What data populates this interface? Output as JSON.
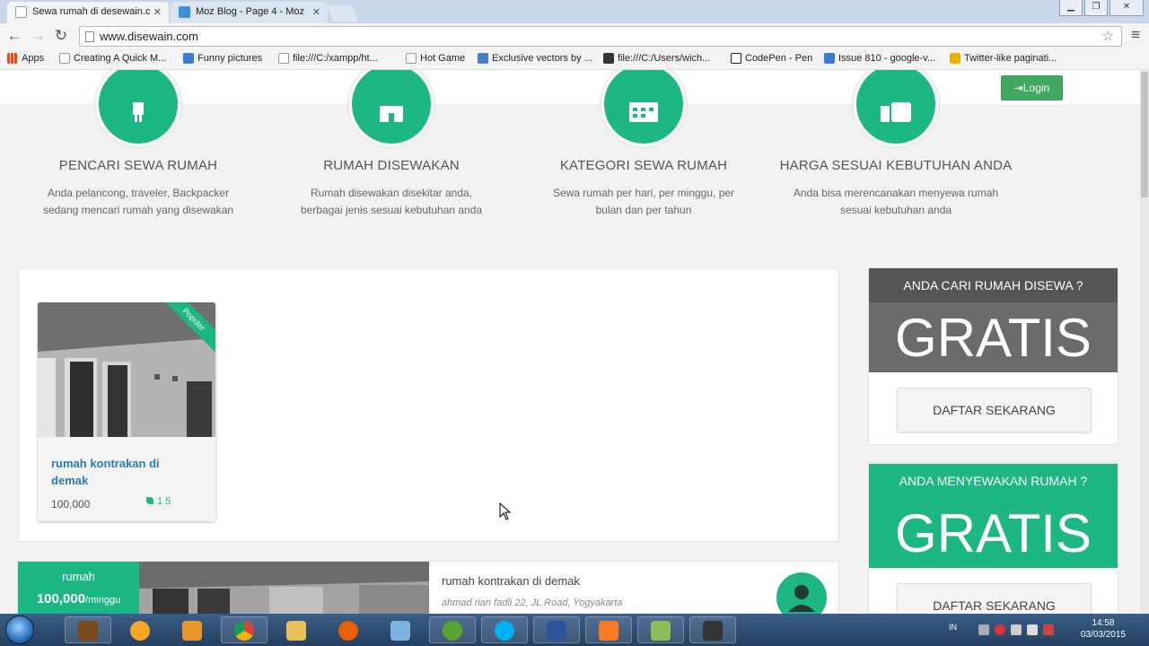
{
  "browser": {
    "tabs": [
      {
        "title": "Sewa rumah di desewain.c",
        "active": true,
        "favicon_color": "#ffffff"
      },
      {
        "title": "Moz Blog - Page 4 - Moz",
        "active": false,
        "favicon_color": "#3d8fe0"
      }
    ],
    "url": "www.disewain.com",
    "bookmarks": [
      {
        "label": "Apps",
        "icon_color": "#e64a19"
      },
      {
        "label": "Creating A Quick M...",
        "icon_color": "#ffffff"
      },
      {
        "label": "Funny pictures",
        "icon_color": "#3a7bd5"
      },
      {
        "label": "file:///C:/xampp/ht...",
        "icon_color": "#ffffff"
      },
      {
        "label": "Hot Game",
        "icon_color": "#ffffff"
      },
      {
        "label": "Exclusive vectors by ...",
        "icon_color": "#4a7fc1"
      },
      {
        "label": "file:///C:/Users/wich...",
        "icon_color": "#333333"
      },
      {
        "label": "CodePen - Pen",
        "icon_color": "#222222"
      },
      {
        "label": "Issue 810 - google-v...",
        "icon_color": "#3c78d8"
      },
      {
        "label": "Twitter-like paginati...",
        "icon_color": "#e8b400"
      }
    ]
  },
  "nav": {
    "login_label": "Login"
  },
  "features": [
    {
      "title": "PENCARI SEWA RUMAH",
      "line1": "Anda pelancong, traveler, Backpacker",
      "line2": "sedang mencari rumah yang disewakan",
      "icon": "person-icon"
    },
    {
      "title": "RUMAH DISEWAKAN",
      "line1": "Rumah disewakan disekitar anda,",
      "line2": "berbagai jenis sesuai kebutuhan anda",
      "icon": "house-icon"
    },
    {
      "title": "KATEGORI SEWA RUMAH",
      "line1": "Sewa rumah per hari, per minggu, per",
      "line2": "bulan dan per tahun",
      "icon": "calendar-icon"
    },
    {
      "title": "HARGA SESUAI KEBUTUHAN ANDA",
      "line1": "Anda bisa merencanakan menyewa rumah",
      "line2": "sesuai kebutuhan anda",
      "icon": "money-icon"
    }
  ],
  "card": {
    "ribbon": "Popular",
    "title": "rumah kontrakan di demak",
    "price": "100,000",
    "tag_count": "1 5"
  },
  "side": {
    "box1": {
      "header": "ANDA CARI RUMAH DISEWA ?",
      "big": "GRATIS",
      "button": "DAFTAR SEKARANG"
    },
    "box2": {
      "header": "ANDA MENYEWAKAN RUMAH ?",
      "big": "GRATIS",
      "button": "DAFTAR SEKARANG"
    }
  },
  "listing": {
    "badge_type": "rumah",
    "badge_price": "100,000",
    "badge_unit": "/minggu",
    "title": "rumah kontrakan di demak",
    "address": "ahmad rian fadli 22, JL Road, Yogyakarta"
  },
  "taskbar": {
    "lang": "IN",
    "time": "14:58",
    "date": "03/03/2015"
  },
  "colors": {
    "accent": "#1cb784",
    "login": "#41a85f",
    "dark_box": "#555555"
  }
}
